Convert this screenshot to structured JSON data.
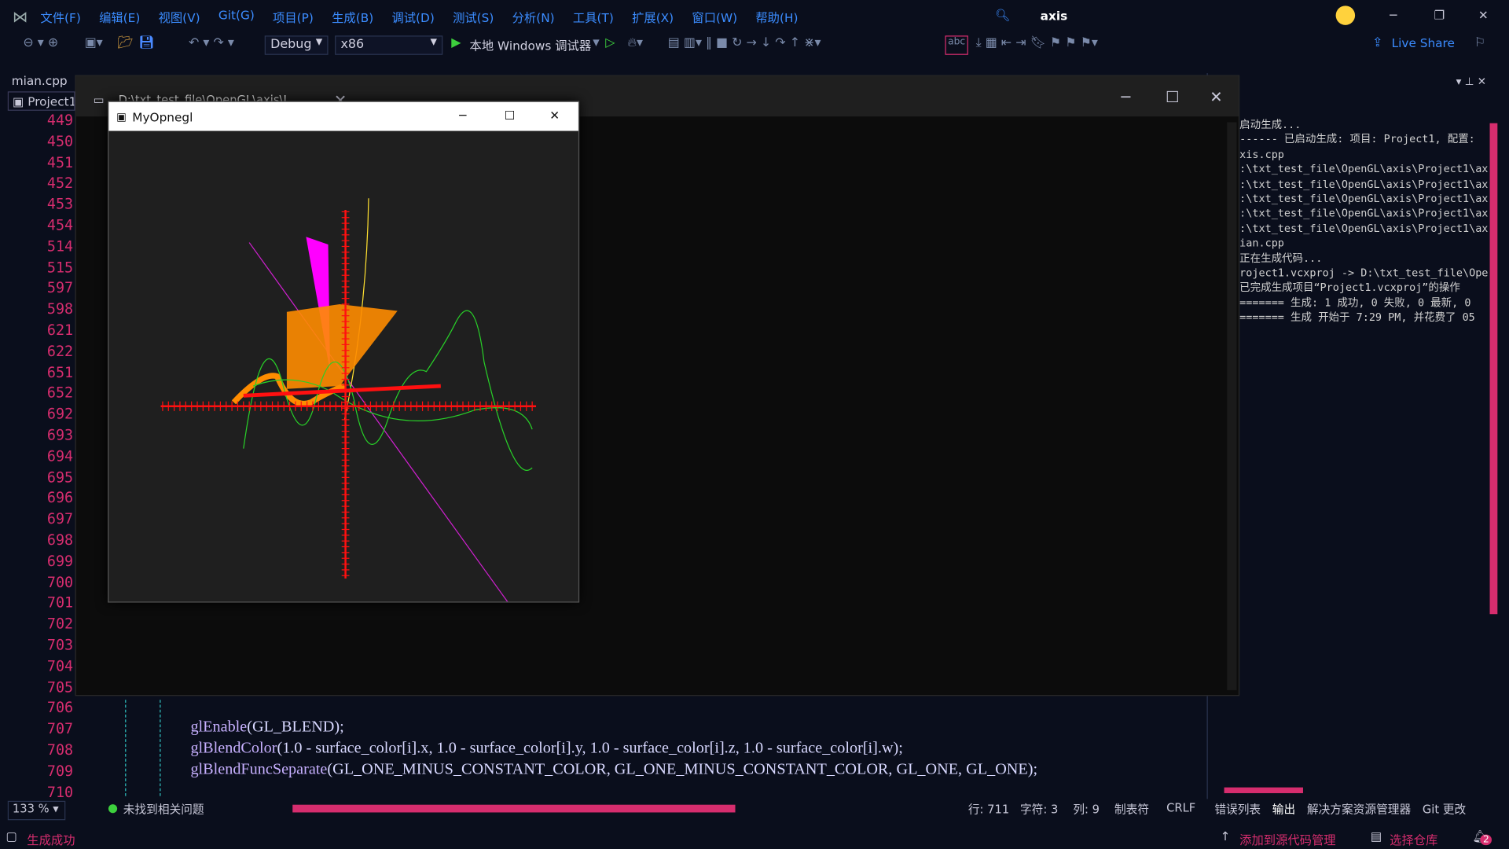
{
  "menu": {
    "items": [
      "文件(F)",
      "编辑(E)",
      "视图(V)",
      "Git(G)",
      "项目(P)",
      "生成(B)",
      "调试(D)",
      "测试(S)",
      "分析(N)",
      "工具(T)",
      "扩展(X)",
      "窗口(W)",
      "帮助(H)"
    ],
    "solution": "axis"
  },
  "toolbar": {
    "config": "Debug",
    "platform": "x86",
    "debugger": "本地 Windows 调试器",
    "live_share": "Live Share"
  },
  "editor": {
    "file_tab": "mian.cpp",
    "project": "Project1",
    "line_numbers": [
      "449",
      "450",
      "451",
      "452",
      "453",
      "454",
      "514",
      "515",
      "597",
      "598",
      "621",
      "622",
      "651",
      "652",
      "692",
      "693",
      "694",
      "695",
      "696",
      "697",
      "698",
      "699",
      "700",
      "701",
      "702",
      "703",
      "704",
      "705",
      "706",
      "707",
      "708",
      "709",
      "710"
    ],
    "code_lines": [
      {
        "a": "glEnable",
        "b": "(GL_BLEND);"
      },
      {
        "a": "glBlendColor",
        "b": "(1.0 - surface_color[i].x, 1.0 - surface_color[i].y, 1.0 - surface_color[i].z, 1.0 - surface_color[i].w);"
      },
      {
        "a": "glBlendFuncSeparate",
        "b": "(GL_ONE_MINUS_CONSTANT_COLOR, GL_ONE_MINUS_CONSTANT_COLOR, GL_ONE, GL_ONE);"
      }
    ]
  },
  "terminal": {
    "tab_title": "D:\\txt_test_file\\OpenGL\\axis\\I"
  },
  "ogl_window": {
    "title": "MyOpnegl"
  },
  "output": {
    "lines": [
      "启动生成...",
      "------ 已启动生成: 项目: Project1, 配置:",
      "xis.cpp",
      ":\\txt_test_file\\OpenGL\\axis\\Project1\\ax",
      ":\\txt_test_file\\OpenGL\\axis\\Project1\\ax",
      ":\\txt_test_file\\OpenGL\\axis\\Project1\\ax",
      ":\\txt_test_file\\OpenGL\\axis\\Project1\\ax",
      ":\\txt_test_file\\OpenGL\\axis\\Project1\\ax",
      "ian.cpp",
      "正在生成代码...",
      "roject1.vcxproj -> D:\\txt_test_file\\Ope",
      "已完成生成项目“Project1.vcxproj”的操作",
      "======= 生成: 1 成功, 0 失败, 0 最新, 0",
      "======= 生成 开始于 7:29 PM, 并花费了 05"
    ]
  },
  "status": {
    "zoom": "133 %",
    "issues": "未找到相关问题",
    "line": "行: 711",
    "char": "字符: 3",
    "col": "列: 9",
    "tabs": "制表符",
    "eol": "CRLF"
  },
  "panel_tabs": [
    "错误列表",
    "输出",
    "解决方案资源管理器",
    "Git 更改"
  ],
  "bottom": {
    "build": "生成成功",
    "source": "添加到源代码管理",
    "repo": "选择仓库",
    "notif": "2"
  }
}
